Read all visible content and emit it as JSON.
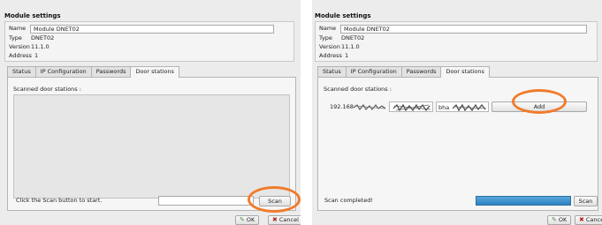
{
  "left": {
    "title": "Module settings",
    "name_label": "Name",
    "name_value": "Module DNET02",
    "type_label": "Type",
    "type_value": "DNET02",
    "version_label": "Version",
    "version_value": "11.1.0",
    "address_label": "Address",
    "address_value": "1",
    "tabs": [
      "Status",
      "IP Configuration",
      "Passwords",
      "Door stations"
    ],
    "active_tab": "Door stations",
    "scanned_label": "Scanned door stations :",
    "status_text": "Click the Scan button to start.",
    "scan_label": "Scan",
    "ok_label": "OK",
    "cancel_label": "Cancel"
  },
  "right": {
    "title": "Module settings",
    "name_label": "Name",
    "name_value": "Module DNET02",
    "type_label": "Type",
    "type_value": "DNET02",
    "version_label": "Version",
    "version_value": "11.1.0",
    "address_label": "Address",
    "address_value": "1",
    "tabs": [
      "Status",
      "IP Configuration",
      "Passwords",
      "Door stations"
    ],
    "active_tab": "Door stations",
    "scanned_label": "Scanned door stations :",
    "station_ip": "192.168",
    "station_host_prefix": "bha",
    "add_label": "Add",
    "status_text": "Scan completed!",
    "scan_progress": 1.0,
    "scan_label": "Scan",
    "ok_label": "OK",
    "cancel_label": "Cancel"
  },
  "colors": {
    "highlight": "#f07b2c",
    "progress": "#2e82c0"
  },
  "icons": {
    "ok": "check-icon",
    "cancel": "x-icon"
  }
}
